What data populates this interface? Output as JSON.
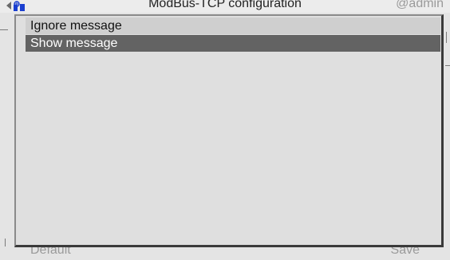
{
  "window": {
    "title": "ModBus-TCP configuration",
    "user": "@admin"
  },
  "footer": {
    "left_label": "Default",
    "right_label": "Save"
  },
  "popup": {
    "options": [
      {
        "label": "Ignore message",
        "selected": false
      },
      {
        "label": "Show message",
        "selected": true
      }
    ]
  },
  "colors": {
    "selected_bg": "#636363",
    "option_bg": "#cfcfcf",
    "logo_blue": "#1a3fd0"
  },
  "icons": [
    "back-arrow-icon",
    "network-logo-icon"
  ]
}
